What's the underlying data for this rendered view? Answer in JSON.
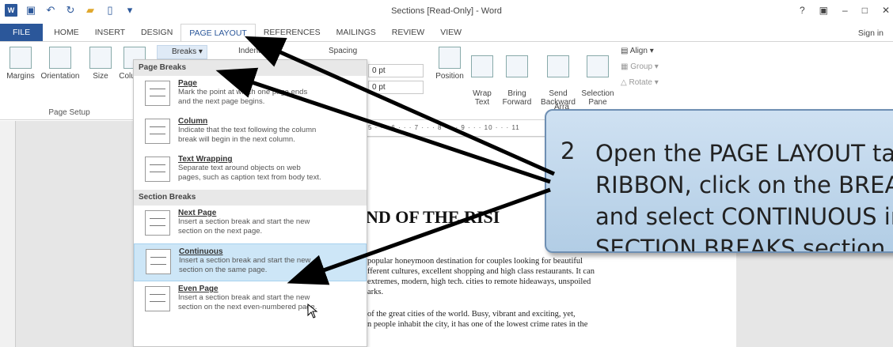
{
  "window": {
    "title": "Sections [Read-Only] - Word",
    "help": "?",
    "sign_in": "Sign in"
  },
  "tabs": [
    "FILE",
    "HOME",
    "INSERT",
    "DESIGN",
    "PAGE LAYOUT",
    "REFERENCES",
    "MAILINGS",
    "REVIEW",
    "VIEW"
  ],
  "ribbon": {
    "margins": "Margins",
    "orientation": "Orientation",
    "size": "Size",
    "columns": "Columns",
    "page_setup": "Page Setup",
    "breaks": "Breaks",
    "indent": "Indent",
    "spacing": "Spacing",
    "spacing_before": "0 pt",
    "spacing_after": "0 pt",
    "position": "Position",
    "wrap_text": "Wrap\nText",
    "bring_forward": "Bring\nForward",
    "send_backward": "Send\nBackward",
    "selection_pane": "Selection\nPane",
    "align": "Align",
    "group": "Group",
    "rotate": "Rotate",
    "arrange": "Arra"
  },
  "ruler": "5 · · · 6 · · · 7 · · · 8 · · · 9 · · · 10 · · · 11",
  "menu": {
    "page_breaks_header": "Page Breaks",
    "section_breaks_header": "Section Breaks",
    "items": [
      {
        "title": "Page",
        "desc": "Mark the point at which one page ends\nand the next page begins."
      },
      {
        "title": "Column",
        "desc": "Indicate that the text following the column\nbreak will begin in the next column."
      },
      {
        "title": "Text Wrapping",
        "desc": "Separate text around objects on web\npages, such as caption text from body text."
      },
      {
        "title": "Next Page",
        "desc": "Insert a section break and start the new\nsection on the next page."
      },
      {
        "title": "Continuous",
        "desc": "Insert a section break and start the new\nsection on the same page."
      },
      {
        "title": "Even Page",
        "desc": "Insert a section break and start the new\nsection on the next even-numbered page."
      }
    ]
  },
  "document": {
    "heading": "ND OF THE RISI",
    "para1": [
      "popular honeymoon destination for couples looking for beautiful",
      "fferent cultures, excellent shopping and high class restaurants. It can",
      "extremes, modern, high tech. cities to remote hideaways, unspoiled",
      "arks."
    ],
    "para2": [
      "of the great cities of the world. Busy, vibrant and exciting, yet,",
      "n people inhabit the city, it has one of the lowest crime rates in the"
    ]
  },
  "callout": {
    "number": "2",
    "text": "Open the PAGE LAYOUT tab\nRIBBON, click on the BREAKS\nand select CONTINUOUS in\nSECTION BREAKS section."
  },
  "colors": {
    "accent": "#2b579a",
    "callout_fill": "#c4d8ec",
    "menu_selected": "#cde6f7"
  }
}
